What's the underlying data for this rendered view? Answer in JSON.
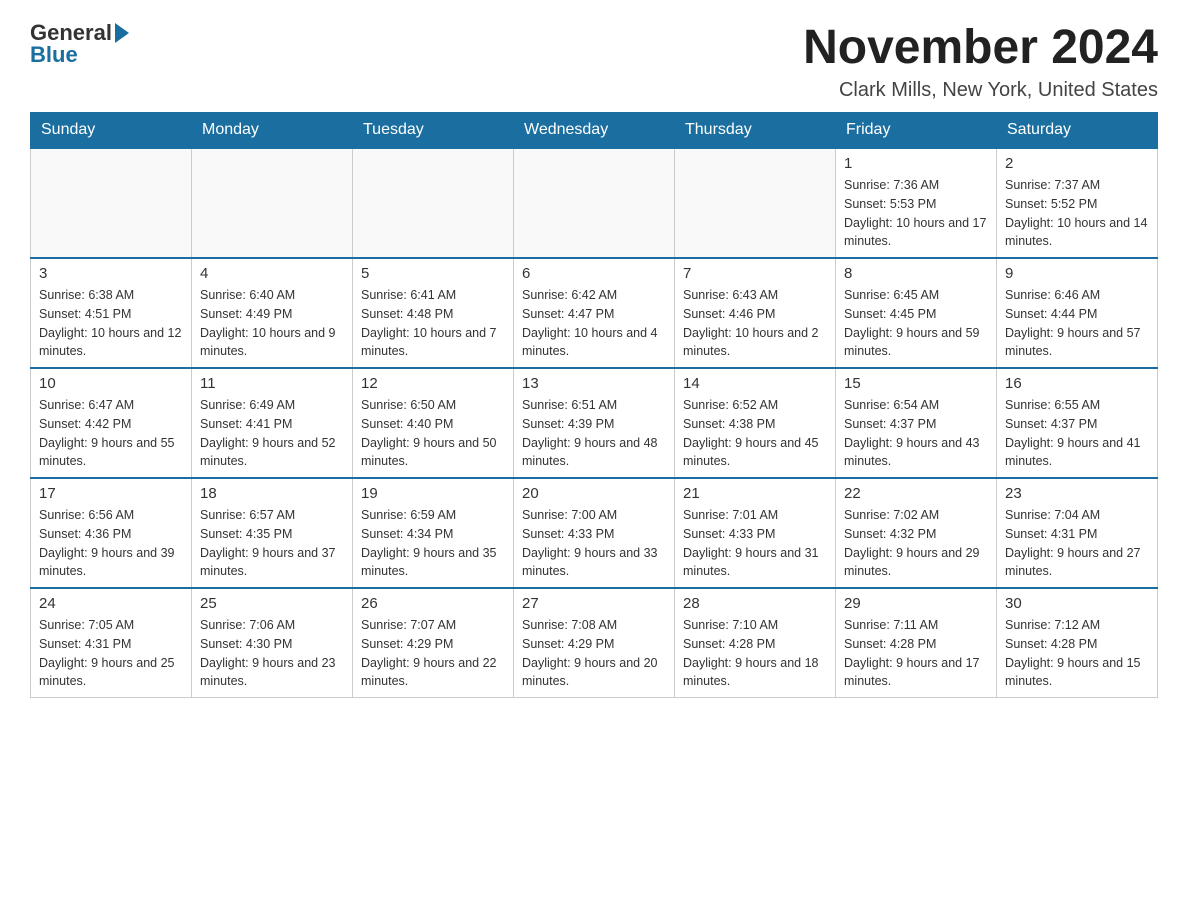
{
  "header": {
    "logo_text": "General",
    "logo_blue": "Blue",
    "month_title": "November 2024",
    "subtitle": "Clark Mills, New York, United States"
  },
  "weekdays": [
    "Sunday",
    "Monday",
    "Tuesday",
    "Wednesday",
    "Thursday",
    "Friday",
    "Saturday"
  ],
  "weeks": [
    {
      "days": [
        {
          "number": "",
          "info": ""
        },
        {
          "number": "",
          "info": ""
        },
        {
          "number": "",
          "info": ""
        },
        {
          "number": "",
          "info": ""
        },
        {
          "number": "",
          "info": ""
        },
        {
          "number": "1",
          "info": "Sunrise: 7:36 AM\nSunset: 5:53 PM\nDaylight: 10 hours and 17 minutes."
        },
        {
          "number": "2",
          "info": "Sunrise: 7:37 AM\nSunset: 5:52 PM\nDaylight: 10 hours and 14 minutes."
        }
      ]
    },
    {
      "days": [
        {
          "number": "3",
          "info": "Sunrise: 6:38 AM\nSunset: 4:51 PM\nDaylight: 10 hours and 12 minutes."
        },
        {
          "number": "4",
          "info": "Sunrise: 6:40 AM\nSunset: 4:49 PM\nDaylight: 10 hours and 9 minutes."
        },
        {
          "number": "5",
          "info": "Sunrise: 6:41 AM\nSunset: 4:48 PM\nDaylight: 10 hours and 7 minutes."
        },
        {
          "number": "6",
          "info": "Sunrise: 6:42 AM\nSunset: 4:47 PM\nDaylight: 10 hours and 4 minutes."
        },
        {
          "number": "7",
          "info": "Sunrise: 6:43 AM\nSunset: 4:46 PM\nDaylight: 10 hours and 2 minutes."
        },
        {
          "number": "8",
          "info": "Sunrise: 6:45 AM\nSunset: 4:45 PM\nDaylight: 9 hours and 59 minutes."
        },
        {
          "number": "9",
          "info": "Sunrise: 6:46 AM\nSunset: 4:44 PM\nDaylight: 9 hours and 57 minutes."
        }
      ]
    },
    {
      "days": [
        {
          "number": "10",
          "info": "Sunrise: 6:47 AM\nSunset: 4:42 PM\nDaylight: 9 hours and 55 minutes."
        },
        {
          "number": "11",
          "info": "Sunrise: 6:49 AM\nSunset: 4:41 PM\nDaylight: 9 hours and 52 minutes."
        },
        {
          "number": "12",
          "info": "Sunrise: 6:50 AM\nSunset: 4:40 PM\nDaylight: 9 hours and 50 minutes."
        },
        {
          "number": "13",
          "info": "Sunrise: 6:51 AM\nSunset: 4:39 PM\nDaylight: 9 hours and 48 minutes."
        },
        {
          "number": "14",
          "info": "Sunrise: 6:52 AM\nSunset: 4:38 PM\nDaylight: 9 hours and 45 minutes."
        },
        {
          "number": "15",
          "info": "Sunrise: 6:54 AM\nSunset: 4:37 PM\nDaylight: 9 hours and 43 minutes."
        },
        {
          "number": "16",
          "info": "Sunrise: 6:55 AM\nSunset: 4:37 PM\nDaylight: 9 hours and 41 minutes."
        }
      ]
    },
    {
      "days": [
        {
          "number": "17",
          "info": "Sunrise: 6:56 AM\nSunset: 4:36 PM\nDaylight: 9 hours and 39 minutes."
        },
        {
          "number": "18",
          "info": "Sunrise: 6:57 AM\nSunset: 4:35 PM\nDaylight: 9 hours and 37 minutes."
        },
        {
          "number": "19",
          "info": "Sunrise: 6:59 AM\nSunset: 4:34 PM\nDaylight: 9 hours and 35 minutes."
        },
        {
          "number": "20",
          "info": "Sunrise: 7:00 AM\nSunset: 4:33 PM\nDaylight: 9 hours and 33 minutes."
        },
        {
          "number": "21",
          "info": "Sunrise: 7:01 AM\nSunset: 4:33 PM\nDaylight: 9 hours and 31 minutes."
        },
        {
          "number": "22",
          "info": "Sunrise: 7:02 AM\nSunset: 4:32 PM\nDaylight: 9 hours and 29 minutes."
        },
        {
          "number": "23",
          "info": "Sunrise: 7:04 AM\nSunset: 4:31 PM\nDaylight: 9 hours and 27 minutes."
        }
      ]
    },
    {
      "days": [
        {
          "number": "24",
          "info": "Sunrise: 7:05 AM\nSunset: 4:31 PM\nDaylight: 9 hours and 25 minutes."
        },
        {
          "number": "25",
          "info": "Sunrise: 7:06 AM\nSunset: 4:30 PM\nDaylight: 9 hours and 23 minutes."
        },
        {
          "number": "26",
          "info": "Sunrise: 7:07 AM\nSunset: 4:29 PM\nDaylight: 9 hours and 22 minutes."
        },
        {
          "number": "27",
          "info": "Sunrise: 7:08 AM\nSunset: 4:29 PM\nDaylight: 9 hours and 20 minutes."
        },
        {
          "number": "28",
          "info": "Sunrise: 7:10 AM\nSunset: 4:28 PM\nDaylight: 9 hours and 18 minutes."
        },
        {
          "number": "29",
          "info": "Sunrise: 7:11 AM\nSunset: 4:28 PM\nDaylight: 9 hours and 17 minutes."
        },
        {
          "number": "30",
          "info": "Sunrise: 7:12 AM\nSunset: 4:28 PM\nDaylight: 9 hours and 15 minutes."
        }
      ]
    }
  ]
}
